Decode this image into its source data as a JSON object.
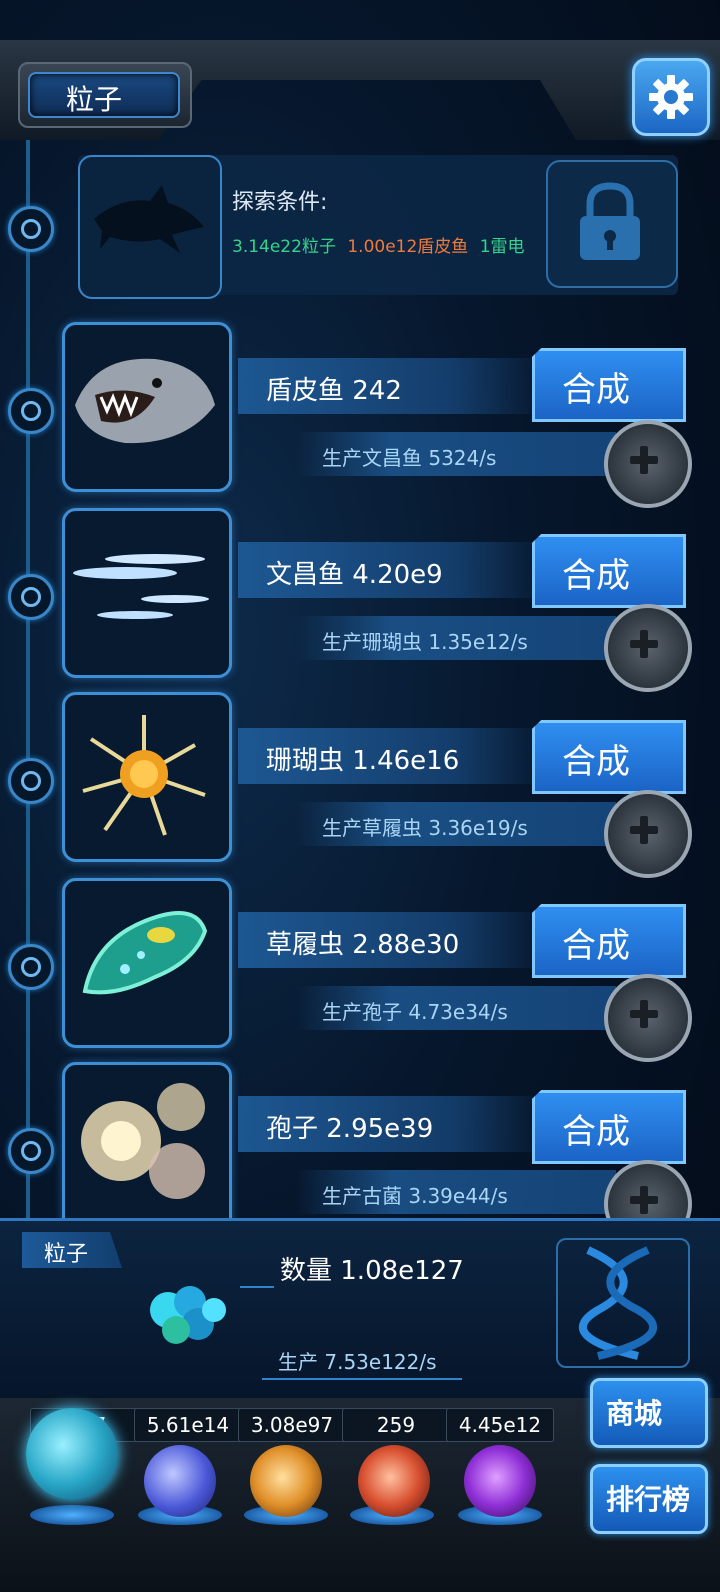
{
  "header": {
    "title": "粒子"
  },
  "locked": {
    "label": "探索条件:",
    "req1": "3.14e22粒子",
    "req2": "1.00e12盾皮鱼",
    "req3": "1雷电",
    "colors": {
      "req1": "#35d48a",
      "req2": "#f07a3c",
      "req3": "#35d48a"
    }
  },
  "creatures": [
    {
      "name": "盾皮鱼 242",
      "produce": "生产文昌鱼 5324/s",
      "button": "合成",
      "icon": "dunkleosteus-icon"
    },
    {
      "name": "文昌鱼 4.20e9",
      "produce": "生产珊瑚虫 1.35e12/s",
      "button": "合成",
      "icon": "lancelet-icon"
    },
    {
      "name": "珊瑚虫 1.46e16",
      "produce": "生产草履虫 3.36e19/s",
      "button": "合成",
      "icon": "coral-polyp-icon"
    },
    {
      "name": "草履虫 2.88e30",
      "produce": "生产孢子 4.73e34/s",
      "button": "合成",
      "icon": "paramecium-icon"
    },
    {
      "name": "孢子 2.95e39",
      "produce": "生产古菌 3.39e44/s",
      "button": "合成",
      "icon": "spore-icon"
    }
  ],
  "particle": {
    "tag": "粒子",
    "count": "数量 1.08e127",
    "production": "生产 7.53e122/s"
  },
  "resources": [
    {
      "value": "1.27",
      "icon": "particle-orb-icon",
      "color": "#3fd0c8"
    },
    {
      "value": "5.61e14",
      "icon": "lightning-orb-icon",
      "color": "#6a7cff"
    },
    {
      "value": "3.08e97",
      "icon": "galaxy-orb-icon",
      "color": "#e8a030"
    },
    {
      "value": "259",
      "icon": "brain-orb-icon",
      "color": "#e0603a"
    },
    {
      "value": "4.45e12",
      "icon": "vortex-orb-icon",
      "color": "#a040e0"
    }
  ],
  "side_buttons": {
    "shop": "商城",
    "ranking": "排行榜"
  }
}
